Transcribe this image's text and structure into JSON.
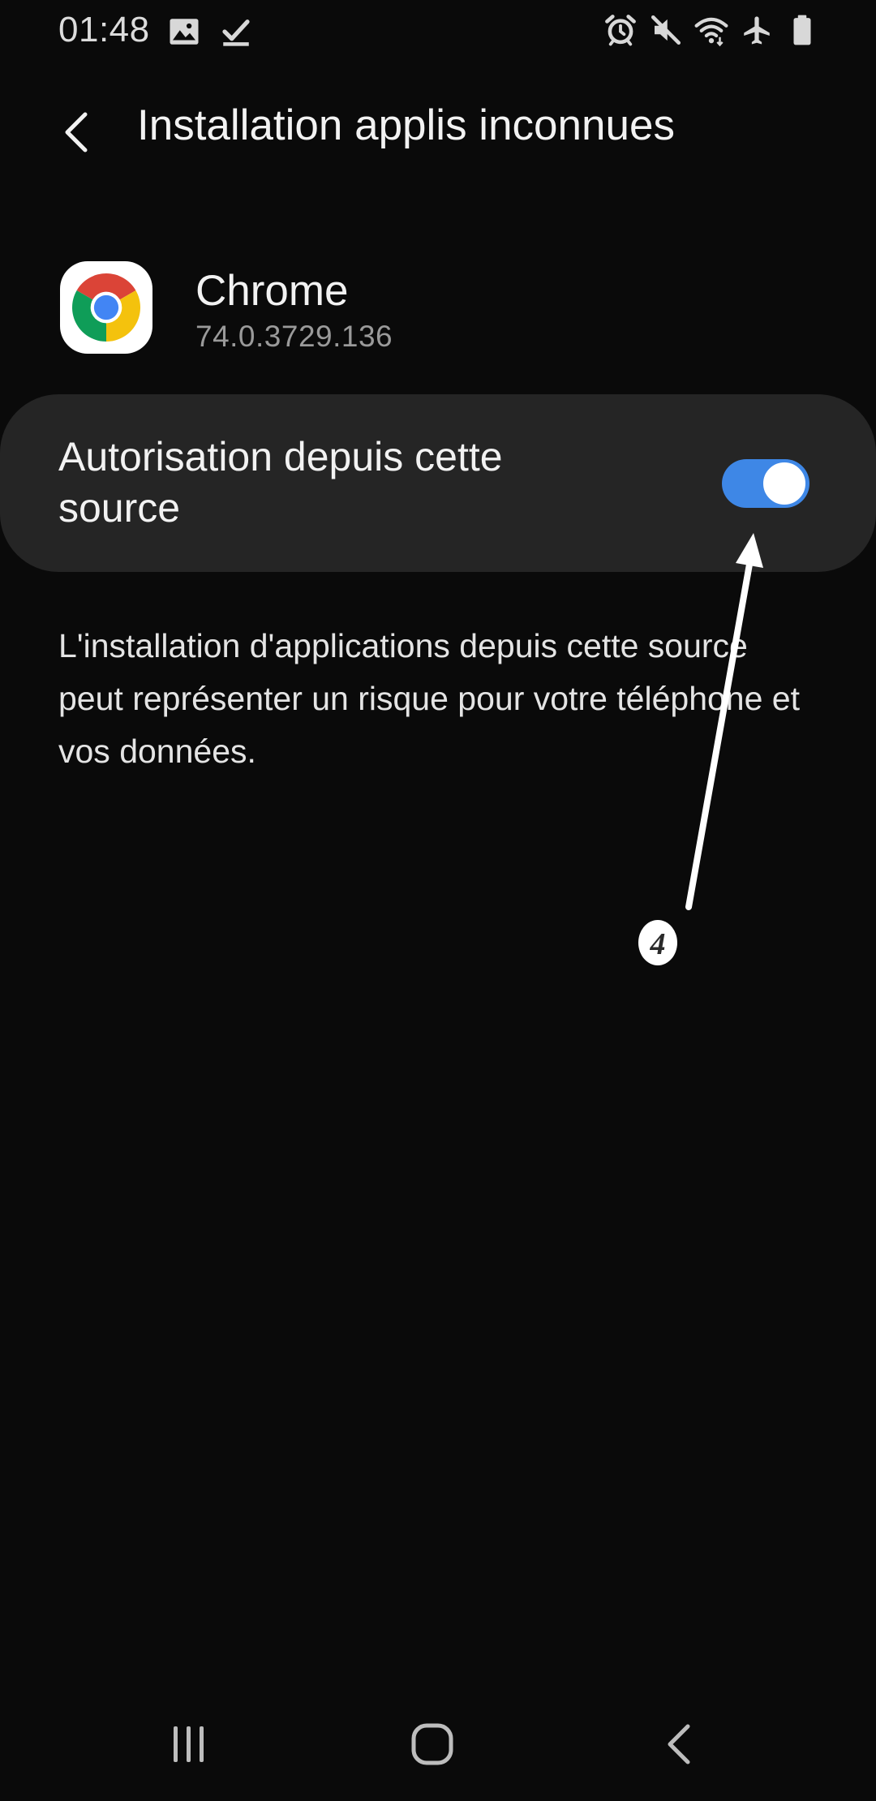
{
  "status_bar": {
    "time": "01:48",
    "left_icons": [
      "image-icon",
      "download-done-icon"
    ],
    "right_icons": [
      "alarm-icon",
      "mute-icon",
      "wifi-icon",
      "airplane-icon",
      "battery-icon"
    ]
  },
  "header": {
    "title": "Installation applis inconnues",
    "back_icon": "chevron-left-icon"
  },
  "app": {
    "name": "Chrome",
    "version": "74.0.3729.136",
    "icon": "chrome-icon"
  },
  "setting": {
    "label": "Autorisation depuis cette source",
    "enabled": true
  },
  "description": "L'installation d'applications depuis cette source peut représenter un risque pour votre téléphone et vos données.",
  "annotation": {
    "marker": "4"
  },
  "nav_bar": {
    "buttons": [
      "recents-icon",
      "home-icon",
      "back-icon"
    ]
  },
  "colors": {
    "background": "#0a0a0a",
    "card": "#252525",
    "accent": "#3e87e6",
    "secondary_text": "#9a9a9a"
  }
}
